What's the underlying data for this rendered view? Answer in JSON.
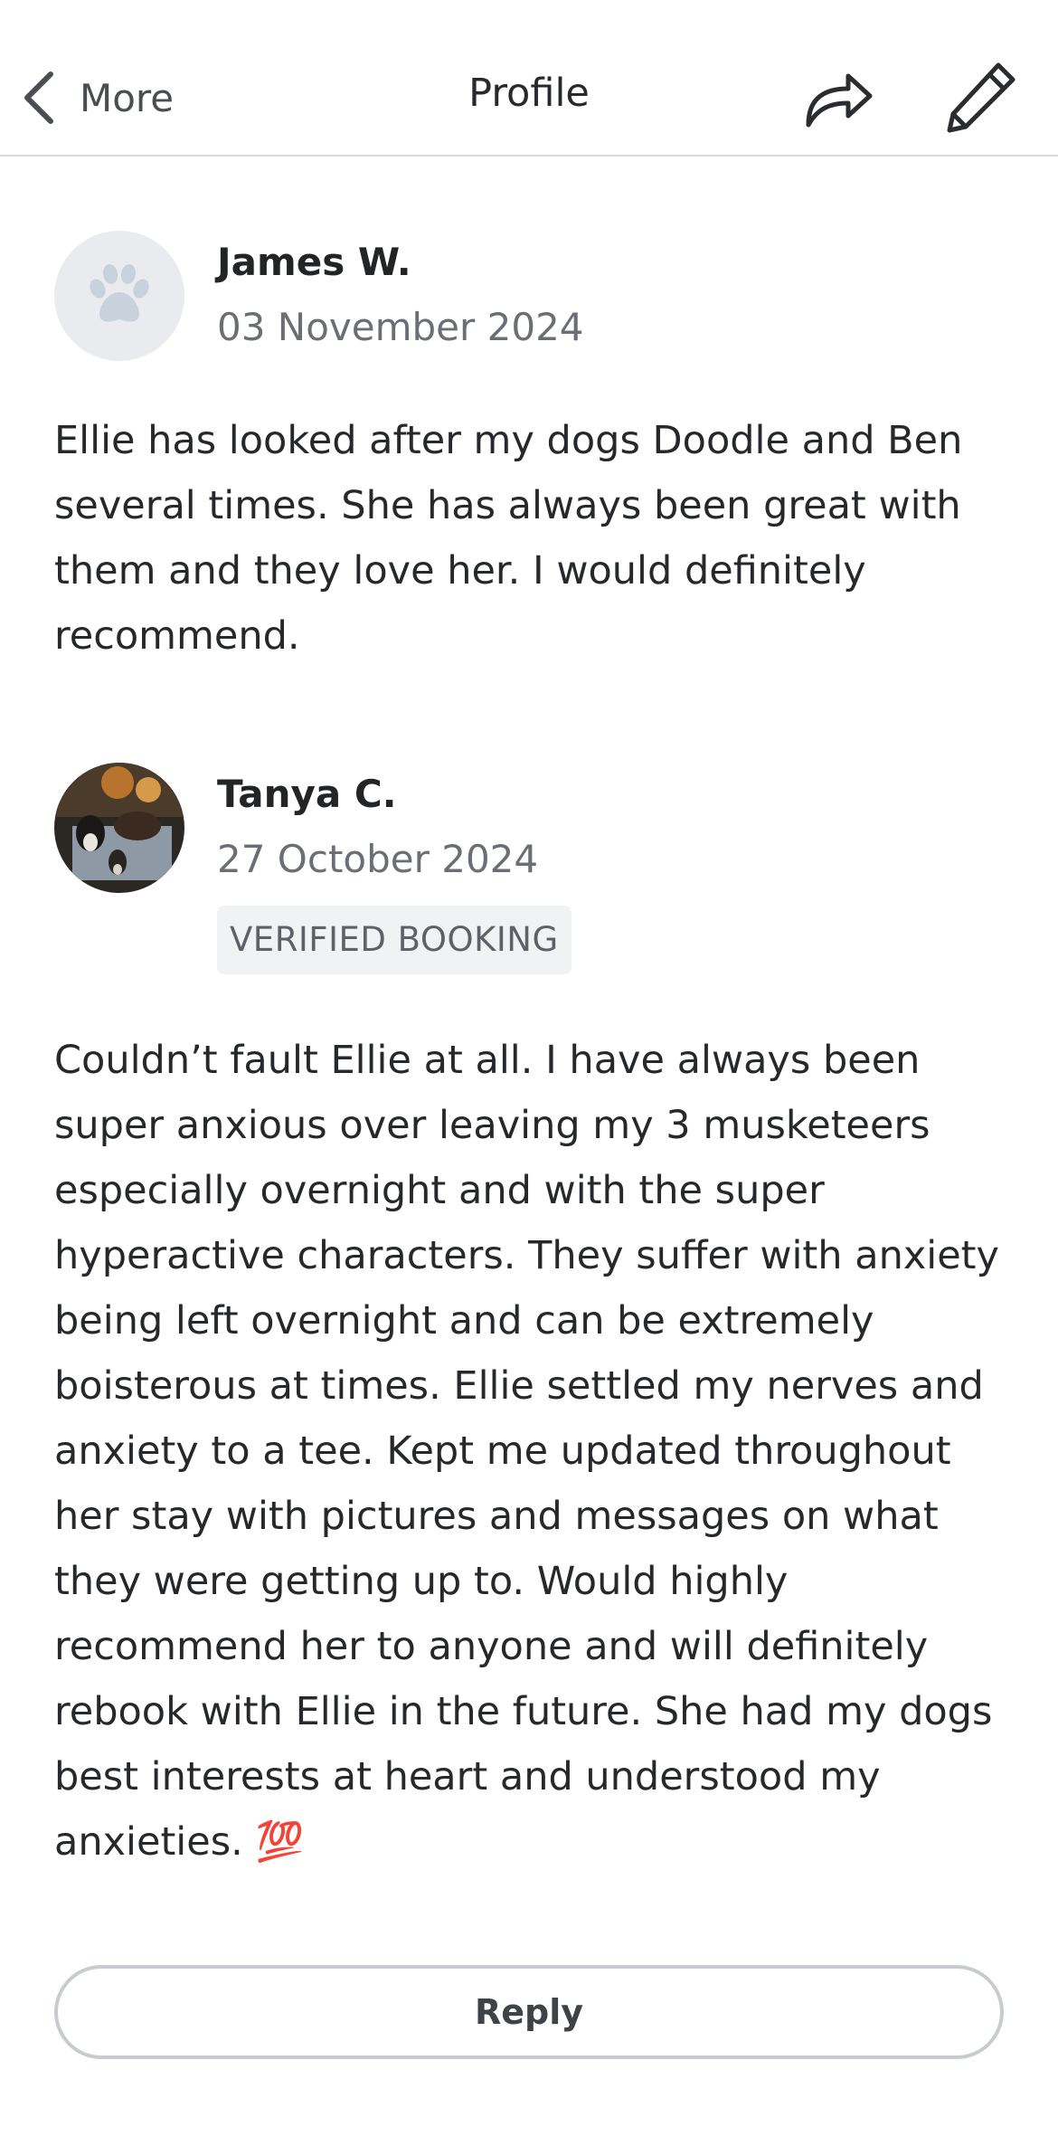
{
  "header": {
    "back_label": "More",
    "title": "Profile",
    "share_icon": "share-arrow-icon",
    "edit_icon": "pencil-icon"
  },
  "reviews": [
    {
      "name": "James W.",
      "date": "03 November 2024",
      "avatar": "paw-placeholder",
      "text": "Ellie has looked after my dogs Doodle and Ben several times. She has always been great with them and they love her. I would definitely recommend."
    },
    {
      "name": "Tanya C.",
      "date": "27 October 2024",
      "avatar": "dogs-photo",
      "badge": "VERIFIED BOOKING",
      "text": "Couldn’t fault Ellie at all. I have always been super anxious over leaving my 3 musketeers especially overnight and with the super hyperactive characters. They suffer with anxiety being left overnight and can be extremely boisterous at times. Ellie settled my nerves and anxiety to a tee. Kept me updated throughout her stay with pictures and messages on what they were getting up to. Would highly recommend her to anyone and will definitely rebook with Ellie in the future. She had my dogs best interests at heart and understood my anxieties. 💯"
    }
  ],
  "reply_label": "Reply",
  "colors": {
    "text": "#222426",
    "muted": "#6b6f75",
    "divider": "#d9dbde",
    "badge_bg": "#f1f2f4"
  }
}
